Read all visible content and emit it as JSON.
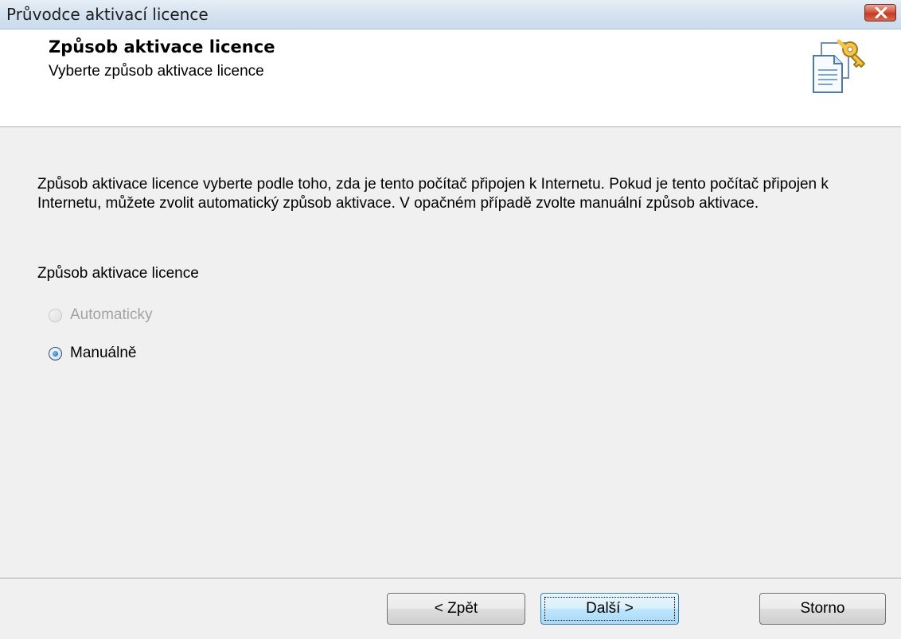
{
  "window": {
    "title": "Průvodce aktivací licence"
  },
  "header": {
    "title": "Způsob aktivace licence",
    "subtitle": "Vyberte způsob aktivace licence",
    "icon": "license-key-document-icon"
  },
  "content": {
    "description": "Způsob aktivace licence vyberte podle toho, zda je tento počítač připojen k Internetu. Pokud je tento počítač připojen k Internetu, můžete zvolit automatický způsob aktivace. V opačném případě zvolte manuální způsob aktivace.",
    "group_label": "Způsob aktivace licence",
    "options": [
      {
        "label": "Automaticky",
        "checked": false,
        "enabled": false
      },
      {
        "label": "Manuálně",
        "checked": true,
        "enabled": true
      }
    ]
  },
  "buttons": {
    "back": "< Zpět",
    "next": "Další >",
    "cancel": "Storno"
  },
  "colors": {
    "accent": "#3c7fb1",
    "close": "#c23c22"
  }
}
